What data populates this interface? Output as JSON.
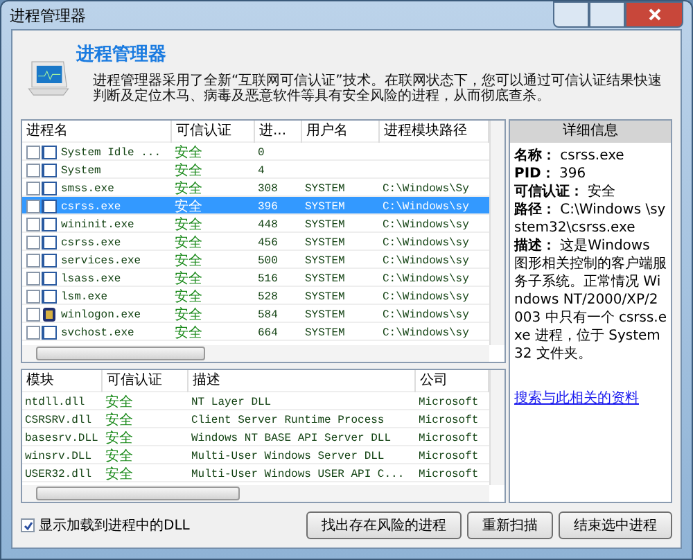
{
  "window": {
    "title": "进程管理器"
  },
  "header": {
    "title": "进程管理器",
    "description": "进程管理器采用了全新“互联网可信认证”技术。在联网状态下，您可以通过可信认证结果快速判断及定位木马、病毒及恶意软件等具有安全风险的进程，从而彻底查杀。"
  },
  "process_table": {
    "columns": [
      "进程名",
      "可信认证",
      "进...",
      "用户名",
      "进程模块路径"
    ],
    "rows": [
      {
        "kind": "window",
        "checked": false,
        "selected": false,
        "cells": [
          "System Idle ...",
          "安全",
          "0",
          "",
          ""
        ]
      },
      {
        "kind": "window",
        "checked": false,
        "selected": false,
        "cells": [
          "System",
          "安全",
          "4",
          "",
          ""
        ]
      },
      {
        "kind": "window",
        "checked": false,
        "selected": false,
        "cells": [
          "smss.exe",
          "安全",
          "308",
          "SYSTEM",
          "C:\\Windows\\Sy"
        ]
      },
      {
        "kind": "window",
        "checked": false,
        "selected": true,
        "cells": [
          "csrss.exe",
          "安全",
          "396",
          "SYSTEM",
          "C:\\Windows\\sy"
        ]
      },
      {
        "kind": "window",
        "checked": false,
        "selected": false,
        "cells": [
          "wininit.exe",
          "安全",
          "448",
          "SYSTEM",
          "C:\\Windows\\sy"
        ]
      },
      {
        "kind": "window",
        "checked": false,
        "selected": false,
        "cells": [
          "csrss.exe",
          "安全",
          "456",
          "SYSTEM",
          "C:\\Windows\\sy"
        ]
      },
      {
        "kind": "window",
        "checked": false,
        "selected": false,
        "cells": [
          "services.exe",
          "安全",
          "500",
          "SYSTEM",
          "C:\\Windows\\sy"
        ]
      },
      {
        "kind": "window",
        "checked": false,
        "selected": false,
        "cells": [
          "lsass.exe",
          "安全",
          "516",
          "SYSTEM",
          "C:\\Windows\\sy"
        ]
      },
      {
        "kind": "window",
        "checked": false,
        "selected": false,
        "cells": [
          "lsm.exe",
          "安全",
          "528",
          "SYSTEM",
          "C:\\Windows\\sy"
        ]
      },
      {
        "kind": "app",
        "checked": false,
        "selected": false,
        "cells": [
          "winlogon.exe",
          "安全",
          "584",
          "SYSTEM",
          "C:\\Windows\\sy"
        ]
      },
      {
        "kind": "window",
        "checked": false,
        "selected": false,
        "cells": [
          "svchost.exe",
          "安全",
          "664",
          "SYSTEM",
          "C:\\Windows\\sy"
        ]
      }
    ]
  },
  "module_table": {
    "columns": [
      "模块",
      "可信认证",
      "描述",
      "公司"
    ],
    "rows": [
      [
        "ntdll.dll",
        "安全",
        "NT Layer DLL",
        "Microsoft"
      ],
      [
        "CSRSRV.dll",
        "安全",
        "Client Server Runtime Process",
        "Microsoft"
      ],
      [
        "basesrv.DLL",
        "安全",
        "Windows NT BASE API Server DLL",
        "Microsoft"
      ],
      [
        "winsrv.DLL",
        "安全",
        "Multi-User Windows Server DLL",
        "Microsoft"
      ],
      [
        "USER32.dll",
        "安全",
        "Multi-User Windows USER API C...",
        "Microsoft"
      ]
    ]
  },
  "details": {
    "title": "详细信息",
    "lines": [
      "**名称：** csrss.exe",
      "**PID：** 396",
      "**可信认证：** 安全",
      "**路径：** C:\\Windows \\system32\\csrss.exe",
      "**描述：** 这是Windows 图形相关控制的客户端服务子系统。正常情况 Windows NT/2000/XP/2003 中只有一个 csrss.exe 进程，位于 System32 文件夹。"
    ],
    "link": "搜索与此相关的资料"
  },
  "show_dll": {
    "label": "显示加载到进程中的DLL",
    "checked": true
  },
  "buttons": [
    "找出存在风险的进程",
    "重新扫描",
    "结束选中进程"
  ]
}
